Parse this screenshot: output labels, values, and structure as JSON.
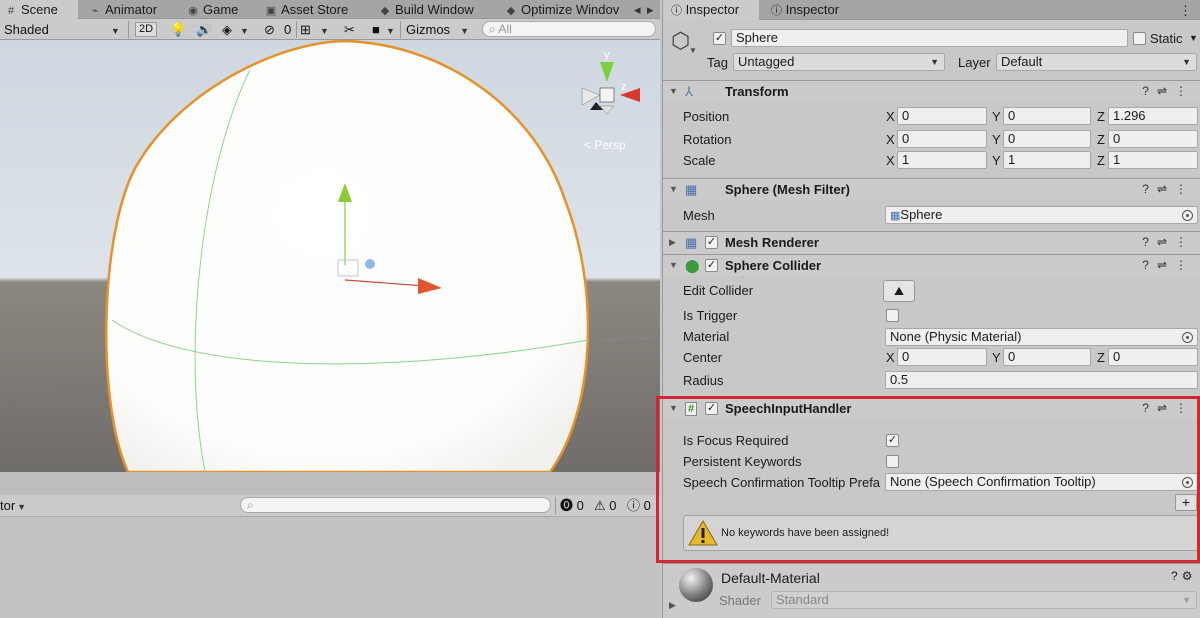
{
  "scene_tabs": [
    {
      "label": "Scene",
      "icon": "hash-icon"
    },
    {
      "label": "Animator",
      "icon": "animator-icon"
    },
    {
      "label": "Game",
      "icon": "gamepad-icon"
    },
    {
      "label": "Asset Store",
      "icon": "store-icon"
    },
    {
      "label": "Build Window",
      "icon": "unity-icon"
    },
    {
      "label": "Optimize Windov",
      "icon": "unity-icon"
    }
  ],
  "scene_toolbar": {
    "shading": "Shaded",
    "mode_2d": "2D",
    "fx_count": "0",
    "gizmos": "Gizmos",
    "search_placeholder": "All"
  },
  "gizmo": {
    "y": "y",
    "z": "z",
    "persp": "Persp"
  },
  "console": {
    "left_label": "tor",
    "counts": [
      "0",
      "0",
      "0"
    ]
  },
  "inspector": {
    "tabs": [
      "Inspector",
      "Inspector"
    ],
    "object_name": "Sphere",
    "static_label": "Static",
    "tag_label": "Tag",
    "tag_value": "Untagged",
    "layer_label": "Layer",
    "layer_value": "Default",
    "transform": {
      "title": "Transform",
      "rows": [
        {
          "label": "Position",
          "x": "0",
          "y": "0",
          "z": "1.296"
        },
        {
          "label": "Rotation",
          "x": "0",
          "y": "0",
          "z": "0"
        },
        {
          "label": "Scale",
          "x": "1",
          "y": "1",
          "z": "1"
        }
      ],
      "axis_x": "X",
      "axis_y": "Y",
      "axis_z": "Z"
    },
    "mesh_filter": {
      "title": "Sphere (Mesh Filter)",
      "mesh_label": "Mesh",
      "mesh_value": "Sphere"
    },
    "mesh_renderer": {
      "title": "Mesh Renderer"
    },
    "sphere_collider": {
      "title": "Sphere Collider",
      "edit_collider": "Edit Collider",
      "is_trigger": "Is Trigger",
      "material_label": "Material",
      "material_value": "None (Physic Material)",
      "center_label": "Center",
      "center": {
        "x": "0",
        "y": "0",
        "z": "0"
      },
      "radius_label": "Radius",
      "radius_value": "0.5"
    },
    "speech": {
      "title": "SpeechInputHandler",
      "focus_required": "Is Focus Required",
      "persistent_keywords": "Persistent Keywords",
      "tooltip_label": "Speech Confirmation Tooltip Prefa",
      "tooltip_value": "None (Speech Confirmation Tooltip)",
      "add": "+",
      "warning": "No keywords have been assigned!"
    },
    "material": {
      "name": "Default-Material",
      "shader_label": "Shader",
      "shader_value": "Standard"
    }
  },
  "colors": {
    "highlight": "#d32632",
    "selection_outline": "#e5922a"
  }
}
